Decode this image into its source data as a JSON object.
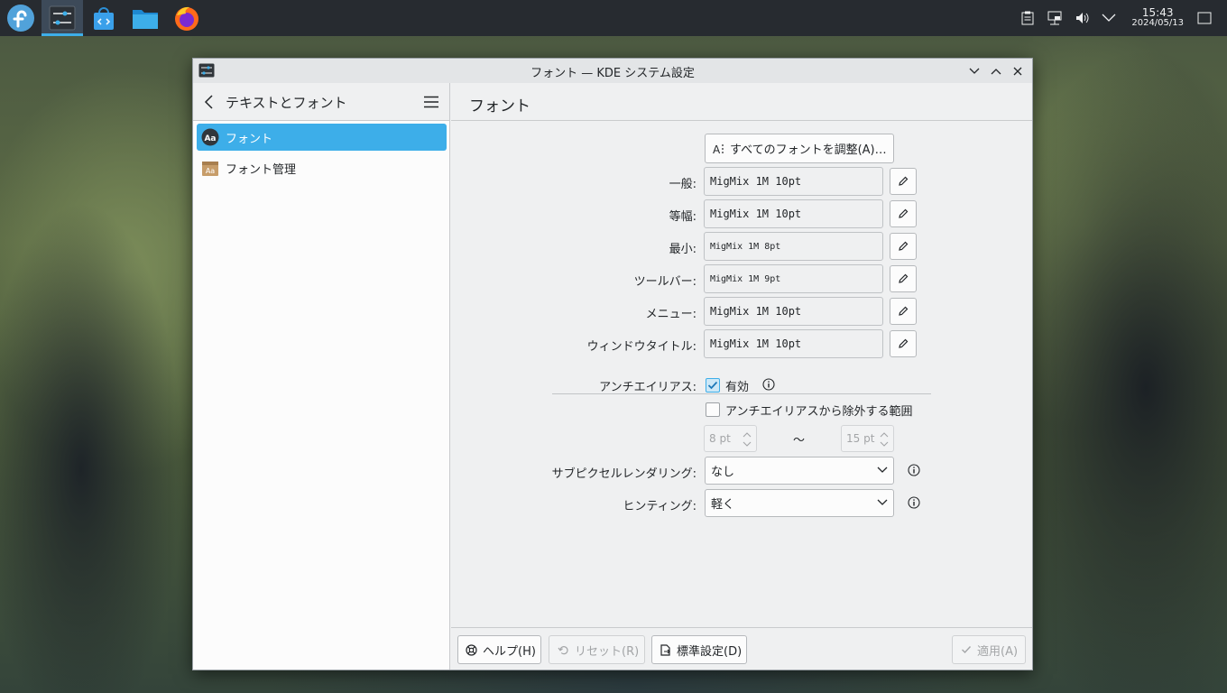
{
  "taskbar": {
    "apps": [
      {
        "name": "fedora-launcher"
      },
      {
        "name": "system-settings",
        "active": true
      },
      {
        "name": "discover"
      },
      {
        "name": "dolphin"
      },
      {
        "name": "firefox"
      }
    ],
    "clock": {
      "time": "15:43",
      "date": "2024/05/13"
    }
  },
  "window": {
    "title": "フォント — KDE システム設定"
  },
  "sidebar": {
    "title": "テキストとフォント",
    "items": [
      {
        "label": "フォント",
        "icon": "font-icon",
        "selected": true
      },
      {
        "label": "フォント管理",
        "icon": "font-manager-icon",
        "selected": false
      }
    ]
  },
  "main": {
    "title": "フォント",
    "adjust_all_button": "すべてのフォントを調整(A)…",
    "fonts": [
      {
        "label": "一般:",
        "value": "MigMix 1M 10pt"
      },
      {
        "label": "等幅:",
        "value": "MigMix 1M 10pt"
      },
      {
        "label": "最小:",
        "value": "MigMix 1M 8pt"
      },
      {
        "label": "ツールバー:",
        "value": "MigMix 1M 9pt"
      },
      {
        "label": "メニュー:",
        "value": "MigMix 1M 10pt"
      },
      {
        "label": "ウィンドウタイトル:",
        "value": "MigMix 1M 10pt"
      }
    ],
    "antialias": {
      "label": "アンチエイリアス:",
      "enabled_label": "有効",
      "enabled": true,
      "exclude_label": "アンチエイリアスから除外する範囲",
      "exclude": false,
      "from": "8 pt",
      "tilde": "〜",
      "to": "15 pt"
    },
    "subpixel": {
      "label": "サブピクセルレンダリング:",
      "value": "なし"
    },
    "hinting": {
      "label": "ヒンティング:",
      "value": "軽く"
    }
  },
  "footer": {
    "help": "ヘルプ(H)",
    "reset": "リセット(R)",
    "defaults": "標準設定(D)",
    "apply": "適用(A)"
  },
  "colors": {
    "accent": "#3daee9",
    "taskbar": "#272b30",
    "window_bg": "#eff0f1"
  }
}
